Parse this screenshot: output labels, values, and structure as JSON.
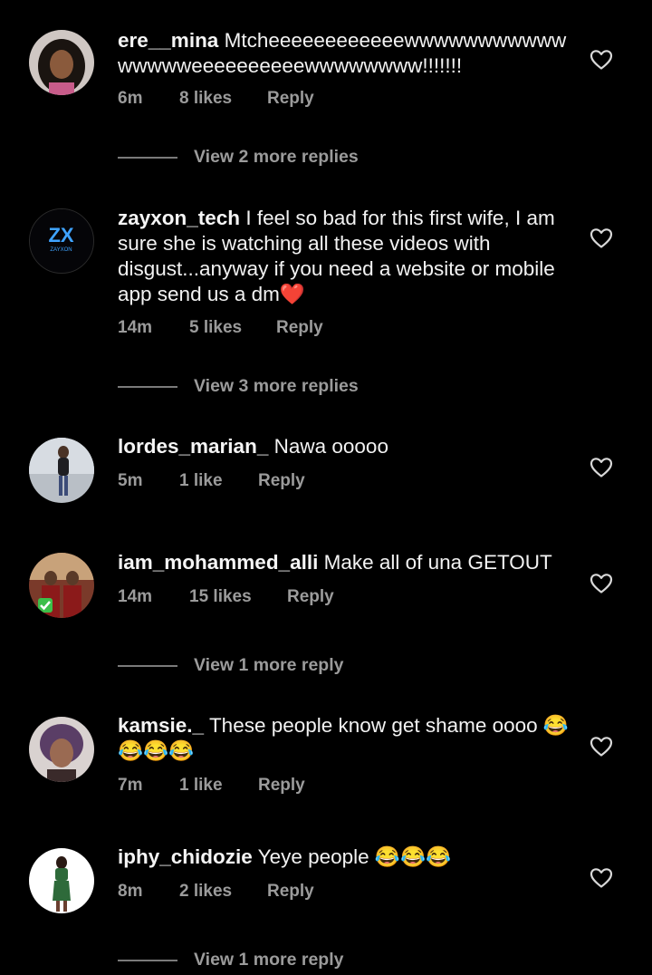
{
  "comments": [
    {
      "username": "ere__mina",
      "text": "Mtcheeeeeeeeeeeewwwwwwwwwwwwwwwweeeeeeeeeewwwwwwww!!!!!!!",
      "time": "6m",
      "likes": "8 likes",
      "reply_label": "Reply",
      "view_replies": "View 2 more replies",
      "avatar_icon": "user-avatar"
    },
    {
      "username": "zayxon_tech",
      "text": "I feel so bad for this first wife, I am sure she is watching all these videos with disgust...anyway if you need a website or mobile app send us a dm❤️",
      "time": "14m",
      "likes": "5 likes",
      "reply_label": "Reply",
      "view_replies": "View 3 more replies",
      "avatar_icon": "zayxon-logo",
      "avatar_logo_text": "ZX",
      "avatar_logo_sub": "ZAYXON"
    },
    {
      "username": "lordes_marian_",
      "text": "Nawa ooooo",
      "time": "5m",
      "likes": "1 like",
      "reply_label": "Reply",
      "avatar_icon": "user-avatar"
    },
    {
      "username": "iam_mohammed_alli",
      "text": "Make all of una GETOUT",
      "time": "14m",
      "likes": "15 likes",
      "reply_label": "Reply",
      "view_replies": "View 1 more reply",
      "avatar_icon": "user-avatar"
    },
    {
      "username": "kamsie._",
      "text": "These people know get shame oooo 😂😂😂😂",
      "time": "7m",
      "likes": "1 like",
      "reply_label": "Reply",
      "avatar_icon": "user-avatar"
    },
    {
      "username": "iphy_chidozie",
      "text": "Yeye people 😂😂😂",
      "time": "8m",
      "likes": "2 likes",
      "reply_label": "Reply",
      "view_replies": "View 1 more reply",
      "avatar_icon": "user-avatar"
    }
  ],
  "colors": {
    "background": "#000000",
    "text": "#f2f2f2",
    "muted": "#9b9b9b"
  }
}
